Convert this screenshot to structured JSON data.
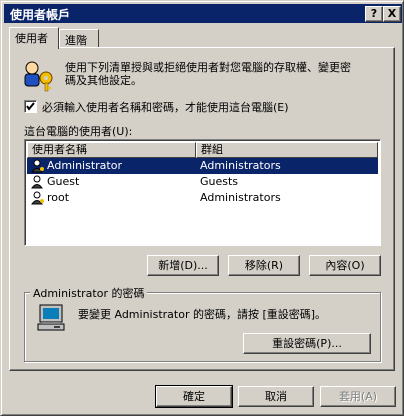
{
  "window": {
    "title": "使用者帳戶",
    "help_glyph": "?",
    "close_glyph": "X"
  },
  "tabs": [
    {
      "label": "使用者"
    },
    {
      "label": "進階"
    }
  ],
  "intro": {
    "line1": "使用下列清單授與或拒絕使用者對您電腦的存取權、變更密",
    "line2": "碼及其他設定。"
  },
  "checkbox": {
    "label": "必須輸入使用者名稱和密碼，才能使用這台電腦(E)",
    "checked": true
  },
  "users_list": {
    "label": "這台電腦的使用者(U):",
    "columns": [
      "使用者名稱",
      "群組"
    ],
    "rows": [
      {
        "name": "Administrator",
        "group": "Administrators",
        "selected": true
      },
      {
        "name": "Guest",
        "group": "Guests",
        "selected": false
      },
      {
        "name": "root",
        "group": "Administrators",
        "selected": false
      }
    ]
  },
  "list_buttons": {
    "add": "新增(D)...",
    "remove": "移除(R)",
    "properties": "內容(O)"
  },
  "password_group": {
    "label": "Administrator 的密碼",
    "text": "要變更 Administrator 的密碼，請按 [重設密碼]。",
    "reset_button": "重設密碼(P)..."
  },
  "footer": {
    "ok": "確定",
    "cancel": "取消",
    "apply": "套用(A)"
  }
}
